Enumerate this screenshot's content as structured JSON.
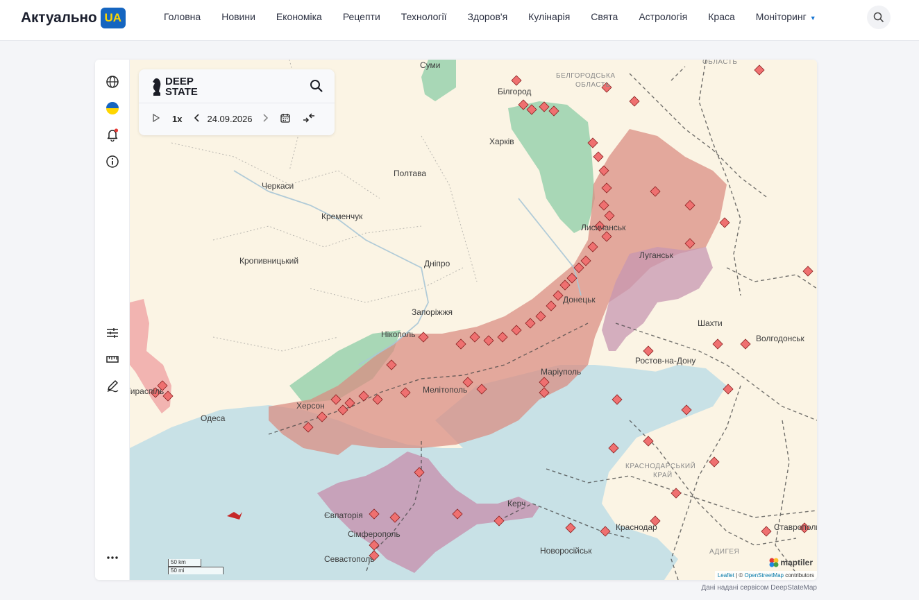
{
  "header": {
    "logo_text": "Актуально",
    "logo_badge": "UA",
    "nav": [
      {
        "label": "Головна"
      },
      {
        "label": "Новини"
      },
      {
        "label": "Економіка"
      },
      {
        "label": "Рецепти"
      },
      {
        "label": "Технології"
      },
      {
        "label": "Здоров'я"
      },
      {
        "label": "Кулінарія"
      },
      {
        "label": "Свята"
      },
      {
        "label": "Астрологія"
      },
      {
        "label": "Краса"
      },
      {
        "label": "Моніторинг"
      }
    ],
    "search_icon": "search-icon"
  },
  "sidebar_tools": [
    "globe-icon",
    "ukraine-flag-icon",
    "bell-icon",
    "info-icon",
    "sliders-icon",
    "ruler-icon",
    "draw-icon",
    "more-icon"
  ],
  "deepstate": {
    "brand_line1": "DEEP",
    "brand_line2": "STATE",
    "speed": "1x",
    "date": "24.09.2026"
  },
  "map": {
    "cities": [
      "Суми",
      "Білгород",
      "Харків",
      "Полтава",
      "Черкаси",
      "Кременчук",
      "Кропивницький",
      "Дніпро",
      "Лисичанськ",
      "Луганськ",
      "Запоріжжя",
      "Нікополь",
      "Донецьк",
      "Шахти",
      "Волгодонськ",
      "Маріуполь",
      "Ростов-на-Дону",
      "Мелітополь",
      "Херсон",
      "Одеса",
      "Тираспіль",
      "Керч",
      "Євпаторія",
      "Сімферополь",
      "Севастополь",
      "Новоросійськ",
      "Краснодар",
      "Ставрополь"
    ],
    "regions": [
      "БЕЛГОРОДСЬКА",
      "ОБЛАСТЬ",
      "ОБЛАСТЬ",
      "КРАСНОДАРСЬКИЙ",
      "КРАЙ",
      "АДИГЕЯ"
    ],
    "scale_km": "50 km",
    "scale_mi": "50 mi",
    "attribution_leaflet": "Leaflet",
    "attribution_osm": "OpenStreetMap",
    "attribution_rest": " contributors",
    "attribution_sep": " | © ",
    "maptiler": "maptiler"
  },
  "footer_note": "Дані надані сервісом DeepStateMap"
}
